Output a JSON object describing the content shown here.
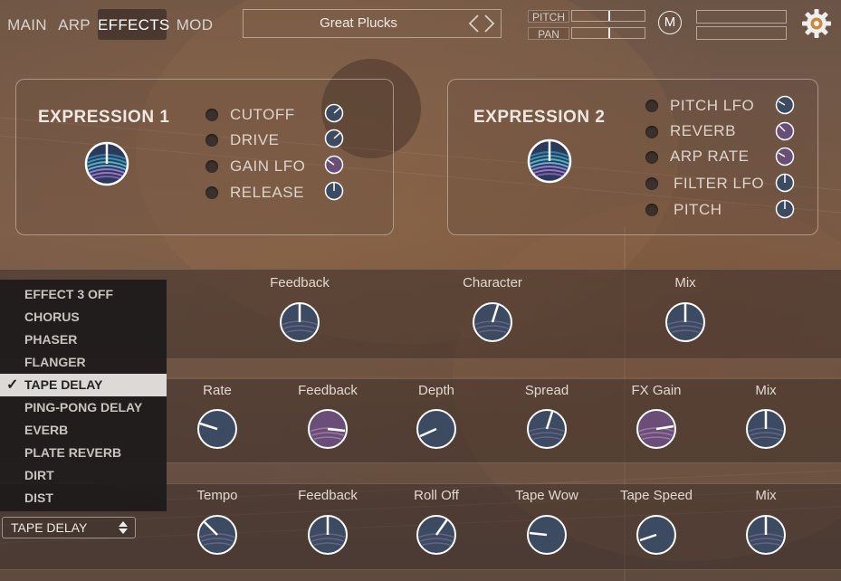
{
  "tabs": [
    {
      "label": "MAIN"
    },
    {
      "label": "ARP"
    },
    {
      "label": "EFFECTS",
      "active": true
    },
    {
      "label": "MOD"
    }
  ],
  "preset": {
    "name": "Great Plucks"
  },
  "pitch_control": {
    "label": "PITCH"
  },
  "pan_control": {
    "label": "PAN"
  },
  "m_button": {
    "label": "M"
  },
  "expression1": {
    "title": "EXPRESSION 1",
    "targets": [
      {
        "label": "CUTOFF"
      },
      {
        "label": "DRIVE"
      },
      {
        "label": "GAIN LFO"
      },
      {
        "label": "RELEASE"
      }
    ]
  },
  "expression2": {
    "title": "EXPRESSION 2",
    "targets": [
      {
        "label": "PITCH LFO"
      },
      {
        "label": "REVERB"
      },
      {
        "label": "ARP RATE"
      },
      {
        "label": "FILTER LFO"
      },
      {
        "label": "PITCH"
      }
    ]
  },
  "effect3": {
    "params": [
      {
        "label": "Feedback"
      },
      {
        "label": "Character"
      },
      {
        "label": "Mix"
      }
    ]
  },
  "effect_mod": {
    "params": [
      {
        "label": "Rate"
      },
      {
        "label": "Feedback"
      },
      {
        "label": "Depth"
      },
      {
        "label": "Spread"
      },
      {
        "label": "FX Gain"
      },
      {
        "label": "Mix"
      }
    ]
  },
  "tape_delay": {
    "params": [
      {
        "label": "Tempo"
      },
      {
        "label": "Feedback"
      },
      {
        "label": "Roll Off"
      },
      {
        "label": "Tape Wow"
      },
      {
        "label": "Tape Speed"
      },
      {
        "label": "Mix"
      }
    ]
  },
  "effect_menu": {
    "check": "✓",
    "items": [
      {
        "label": "EFFECT 3 OFF"
      },
      {
        "label": "CHORUS"
      },
      {
        "label": "PHASER"
      },
      {
        "label": "FLANGER"
      },
      {
        "label": "TAPE DELAY",
        "selected": true
      },
      {
        "label": "PING-PONG DELAY"
      },
      {
        "label": "EVERB"
      },
      {
        "label": "PLATE REVERB"
      },
      {
        "label": "DIRT"
      },
      {
        "label": "DIST"
      }
    ]
  },
  "effect_select": {
    "value": "TAPE DELAY"
  },
  "colors": {
    "knob_fill": "#3c4a62",
    "knob_fill_purple": "#6a4e78",
    "accent_teal": "#4fb6c6",
    "accent_purple": "#9b6cc2"
  }
}
